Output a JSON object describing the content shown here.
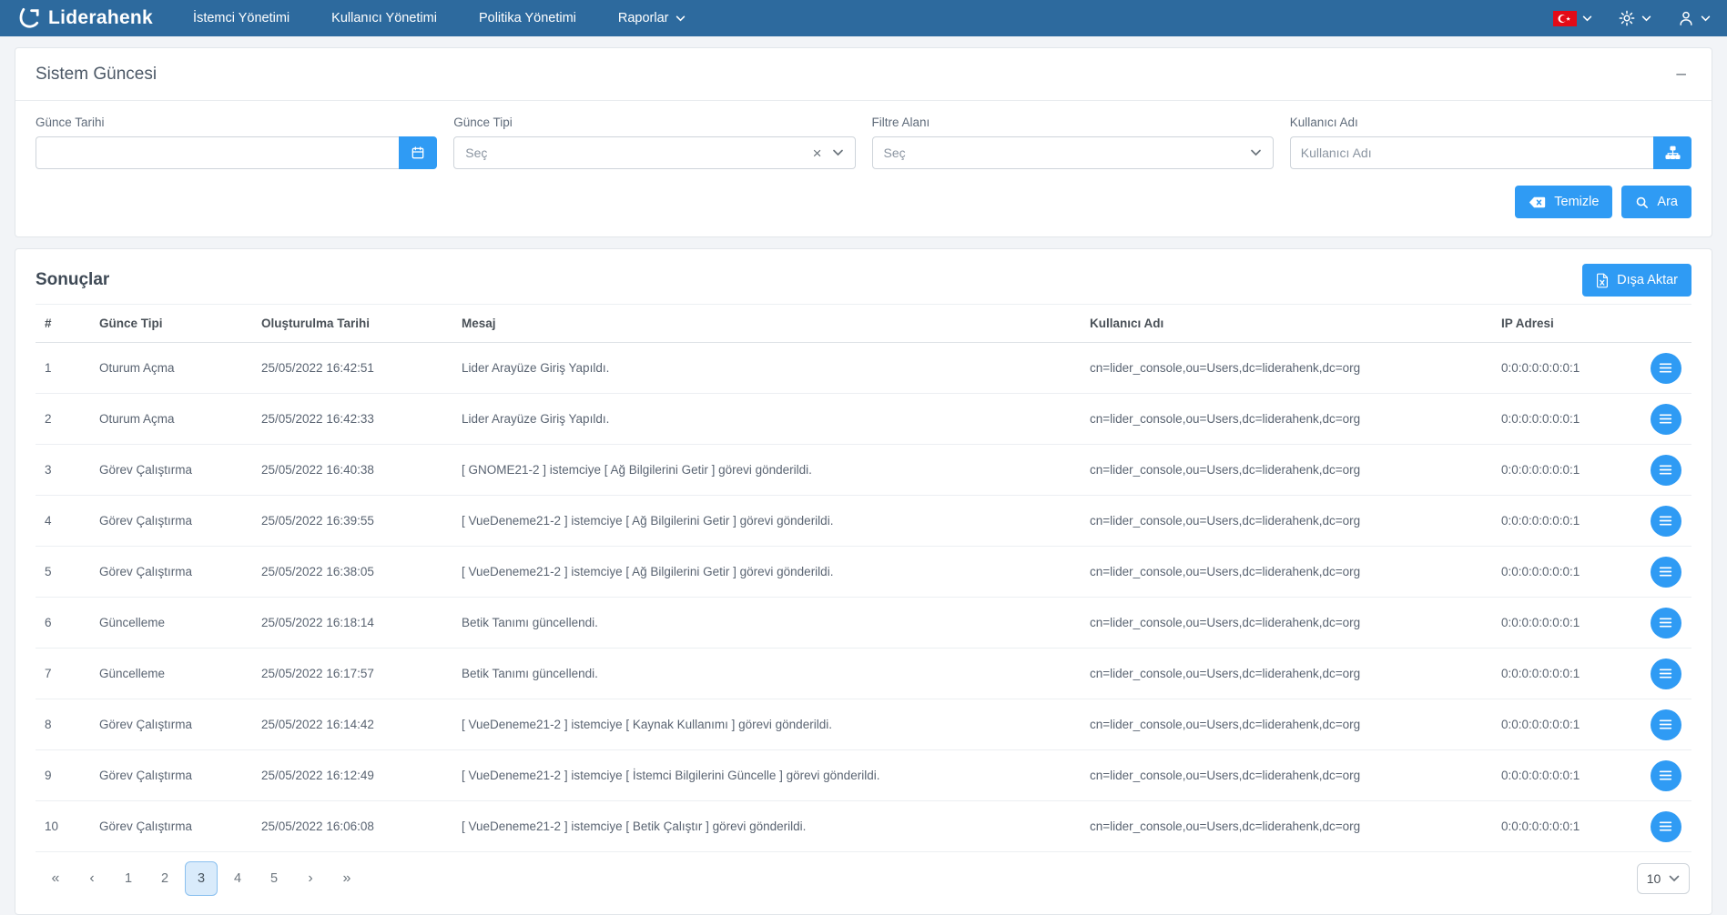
{
  "colors": {
    "navbar": "#2d6a9e",
    "accent": "#2f9bf4",
    "flag_red": "#e30a17",
    "active_page_bg": "#d9ebfb",
    "active_page_border": "#8ac0ef"
  },
  "navbar": {
    "brand": "Liderahenk",
    "items": [
      {
        "label": "İstemci Yönetimi",
        "dropdown": false
      },
      {
        "label": "Kullanıcı Yönetimi",
        "dropdown": false
      },
      {
        "label": "Politika Yönetimi",
        "dropdown": false
      },
      {
        "label": "Raporlar",
        "dropdown": true
      }
    ]
  },
  "filter_panel": {
    "title": "Sistem Güncesi",
    "collapse_glyph": "–",
    "date_label": "Günce Tarihi",
    "type_label": "Günce Tipi",
    "type_placeholder": "Seç",
    "type_clear_glyph": "×",
    "filter_label": "Filtre Alanı",
    "filter_placeholder": "Seç",
    "user_label": "Kullanıcı Adı",
    "user_placeholder": "Kullanıcı Adı",
    "clear_button": "Temizle",
    "search_button": "Ara"
  },
  "results": {
    "title": "Sonuçlar",
    "export_button": "Dışa Aktar",
    "table": {
      "headers": [
        "#",
        "Günce Tipi",
        "Oluşturulma Tarihi",
        "Mesaj",
        "Kullanıcı Adı",
        "IP Adresi"
      ],
      "rows": [
        {
          "num": "1",
          "type": "Oturum Açma",
          "date": "25/05/2022 16:42:51",
          "message": "Lider Arayüze Giriş Yapıldı.",
          "user": "cn=lider_console,ou=Users,dc=liderahenk,dc=org",
          "ip": "0:0:0:0:0:0:0:1"
        },
        {
          "num": "2",
          "type": "Oturum Açma",
          "date": "25/05/2022 16:42:33",
          "message": "Lider Arayüze Giriş Yapıldı.",
          "user": "cn=lider_console,ou=Users,dc=liderahenk,dc=org",
          "ip": "0:0:0:0:0:0:0:1"
        },
        {
          "num": "3",
          "type": "Görev Çalıştırma",
          "date": "25/05/2022 16:40:38",
          "message": "[ GNOME21-2 ] istemciye [ Ağ Bilgilerini Getir ] görevi gönderildi.",
          "user": "cn=lider_console,ou=Users,dc=liderahenk,dc=org",
          "ip": "0:0:0:0:0:0:0:1"
        },
        {
          "num": "4",
          "type": "Görev Çalıştırma",
          "date": "25/05/2022 16:39:55",
          "message": "[ VueDeneme21-2 ] istemciye [ Ağ Bilgilerini Getir ] görevi gönderildi.",
          "user": "cn=lider_console,ou=Users,dc=liderahenk,dc=org",
          "ip": "0:0:0:0:0:0:0:1"
        },
        {
          "num": "5",
          "type": "Görev Çalıştırma",
          "date": "25/05/2022 16:38:05",
          "message": "[ VueDeneme21-2 ] istemciye [ Ağ Bilgilerini Getir ] görevi gönderildi.",
          "user": "cn=lider_console,ou=Users,dc=liderahenk,dc=org",
          "ip": "0:0:0:0:0:0:0:1"
        },
        {
          "num": "6",
          "type": "Güncelleme",
          "date": "25/05/2022 16:18:14",
          "message": "Betik Tanımı güncellendi.",
          "user": "cn=lider_console,ou=Users,dc=liderahenk,dc=org",
          "ip": "0:0:0:0:0:0:0:1"
        },
        {
          "num": "7",
          "type": "Güncelleme",
          "date": "25/05/2022 16:17:57",
          "message": "Betik Tanımı güncellendi.",
          "user": "cn=lider_console,ou=Users,dc=liderahenk,dc=org",
          "ip": "0:0:0:0:0:0:0:1"
        },
        {
          "num": "8",
          "type": "Görev Çalıştırma",
          "date": "25/05/2022 16:14:42",
          "message": "[ VueDeneme21-2 ] istemciye [ Kaynak Kullanımı ] görevi gönderildi.",
          "user": "cn=lider_console,ou=Users,dc=liderahenk,dc=org",
          "ip": "0:0:0:0:0:0:0:1"
        },
        {
          "num": "9",
          "type": "Görev Çalıştırma",
          "date": "25/05/2022 16:12:49",
          "message": "[ VueDeneme21-2 ] istemciye [ İstemci Bilgilerini Güncelle ] görevi gönderildi.",
          "user": "cn=lider_console,ou=Users,dc=liderahenk,dc=org",
          "ip": "0:0:0:0:0:0:0:1"
        },
        {
          "num": "10",
          "type": "Görev Çalıştırma",
          "date": "25/05/2022 16:06:08",
          "message": "[ VueDeneme21-2 ] istemciye [ Betik Çalıştır ] görevi gönderildi.",
          "user": "cn=lider_console,ou=Users,dc=liderahenk,dc=org",
          "ip": "0:0:0:0:0:0:0:1"
        }
      ]
    },
    "pagination": {
      "first_glyph": "«",
      "prev_glyph": "‹",
      "next_glyph": "›",
      "last_glyph": "»",
      "pages": [
        "1",
        "2",
        "3",
        "4",
        "5"
      ],
      "active_page": "3",
      "page_size": "10"
    }
  }
}
